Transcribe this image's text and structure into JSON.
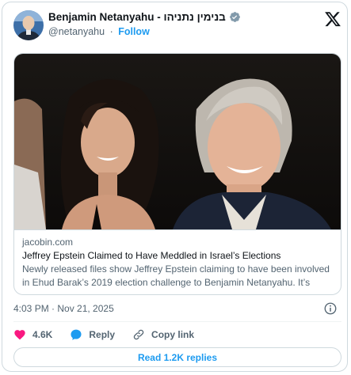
{
  "author": {
    "display_name": "Benjamin Netanyahu - בנימין נתניהו",
    "handle": "@netanyahu",
    "separator": "·",
    "follow_label": "Follow",
    "verified_color": "#829aab"
  },
  "header": {
    "platform_icon": "x-logo-icon"
  },
  "link_card": {
    "domain": "jacobin.com",
    "title": "Jeffrey Epstein Claimed to Have Meddled in Israel’s Elections",
    "description": "Newly released files show Jeffrey Epstein claiming to have been involved in Ehud Barak’s 2019 election challenge to Benjamin Netanyahu. It’s well..."
  },
  "meta": {
    "timestamp": "4:03 PM · Nov 21, 2025"
  },
  "actions": {
    "like_count": "4.6K",
    "reply_label": "Reply",
    "copy_link_label": "Copy link"
  },
  "replies_button": {
    "label": "Read 1.2K replies"
  },
  "colors": {
    "accent": "#1d9bf0",
    "like": "#f91880",
    "secondary_text": "#536471",
    "border": "#cfd9de"
  }
}
